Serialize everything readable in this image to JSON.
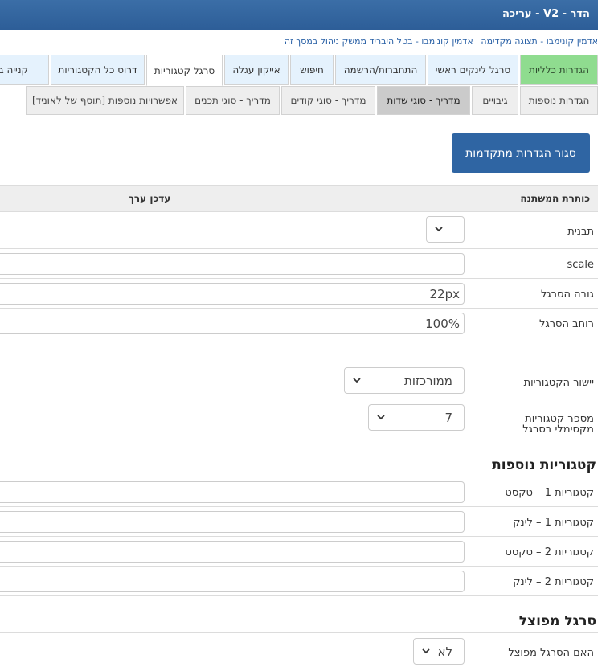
{
  "window": {
    "title": "הדר - V2 - עריכה"
  },
  "breadcrumb": {
    "part1": "אדמין קונימבו - תצוגה מקדימה",
    "part2": "אדמין קונימבו - בטל היבריד ממשק ניהול במסך זה"
  },
  "tabs_row1": [
    "הגדרות כלליות",
    "סרגל לינקים ראשי",
    "התחברות/הרשמה",
    "חיפוש",
    "אייקון עגלה",
    "סרגל קטגוריות",
    "דרוס כל הקטגוריות",
    "קנייה בטוחה"
  ],
  "tabs_row2": [
    "הגדרות נוספות",
    "גיבויים",
    "מדריך - סוגי שדות",
    "מדריך - סוגי קודים",
    "מדריך - סוגי תכנים",
    "אפשרויות נוספות [תוסף של לאוניד]"
  ],
  "advanced_button": "סגור הגדרות מתקדמות",
  "table": {
    "col_name": "כותרת המשתנה",
    "col_value": "עדכן ערך"
  },
  "fields": {
    "template": {
      "label": "תבנית",
      "value": ""
    },
    "scale": {
      "label": "scale",
      "value": ""
    },
    "bar_height": {
      "label": "גובה הסרגל",
      "value": "22px"
    },
    "bar_width": {
      "label": "רוחב הסרגל",
      "value": "100%"
    },
    "alignment": {
      "label": "יישור הקטגוריות",
      "value": "ממורכזות"
    },
    "max_categories": {
      "label": "מספר קטגוריות מקסימלי בסרגל",
      "value": "7"
    }
  },
  "extra_categories": {
    "title": "קטגוריות נוספות",
    "rows": [
      {
        "label": "קטגוריות 1 – טקסט",
        "value": ""
      },
      {
        "label": "קטגוריות 1 – לינק",
        "value": ""
      },
      {
        "label": "קטגוריות 2 – טקסט",
        "value": ""
      },
      {
        "label": "קטגוריות 2 – לינק",
        "value": ""
      }
    ]
  },
  "split_bar": {
    "title": "סרגל מפוצל",
    "label": "האם הסרגל מפוצל",
    "value": "לא"
  }
}
